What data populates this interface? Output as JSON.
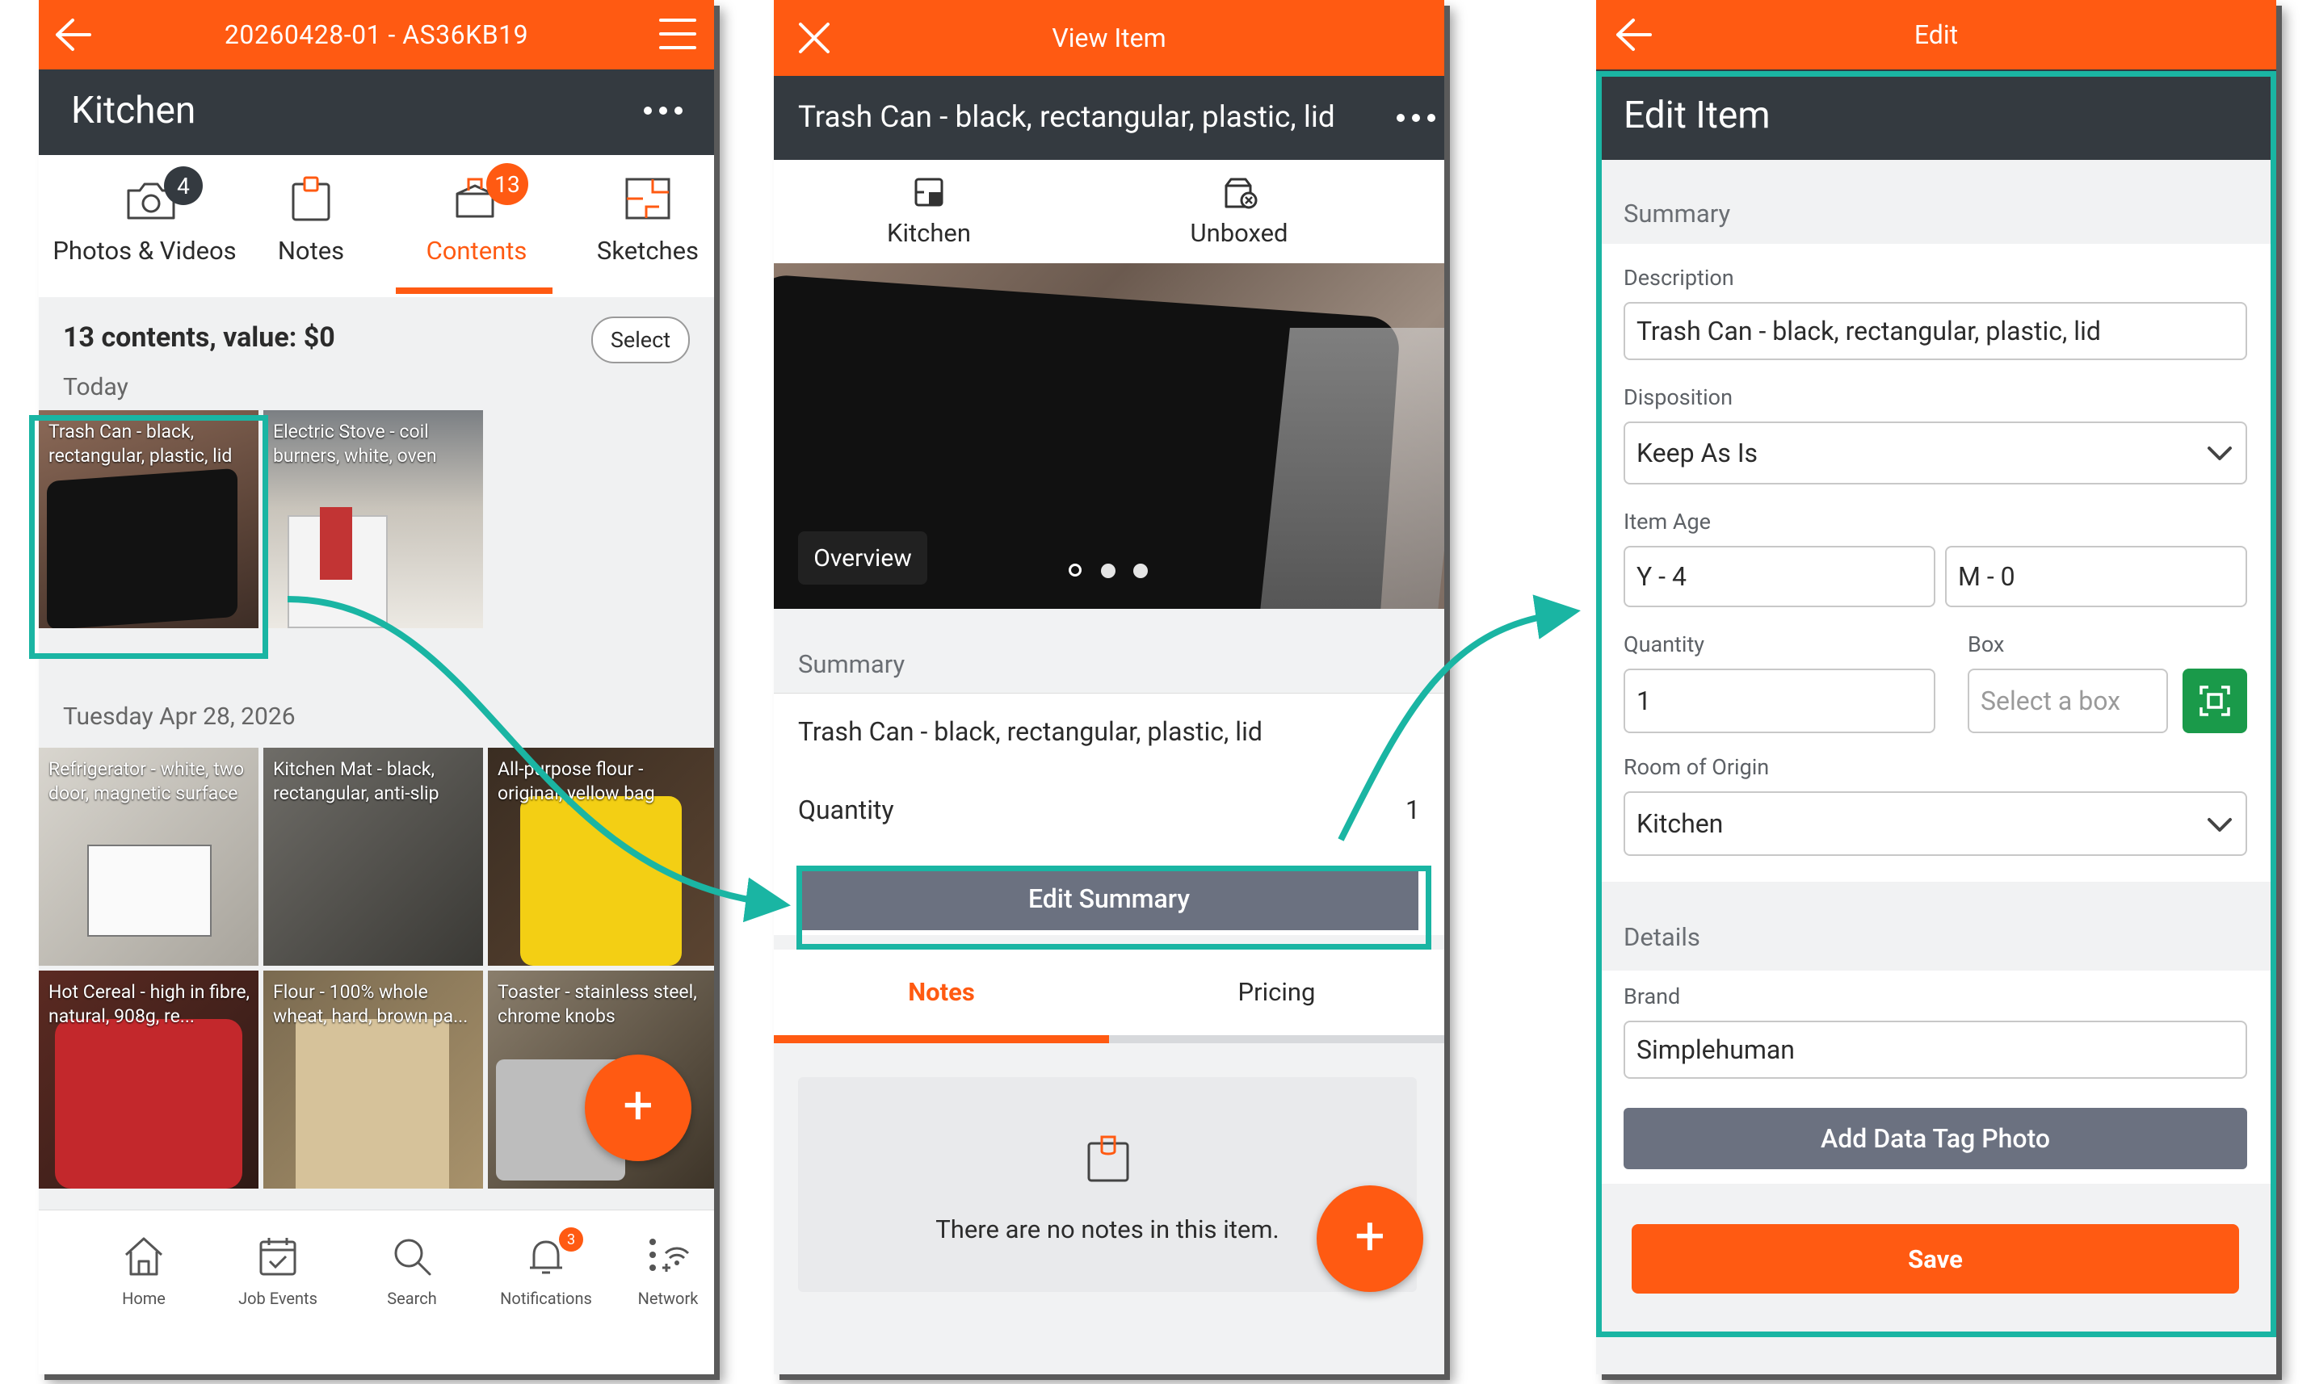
{
  "panel1": {
    "header_title": "20260428-01 - AS36KB19",
    "room_title": "Kitchen",
    "tabs": [
      {
        "label": "Photos & Videos",
        "badge": "4"
      },
      {
        "label": "Notes",
        "badge": ""
      },
      {
        "label": "Contents",
        "badge": "13"
      },
      {
        "label": "Sketches",
        "badge": ""
      }
    ],
    "contents_summary": "13 contents, value: $0",
    "select_label": "Select",
    "group_today": "Today",
    "group_date": "Tuesday Apr 28, 2026",
    "today_items": [
      {
        "caption": "Trash Can - black, rectangular, plastic, lid"
      },
      {
        "caption": "Electric Stove - coil burners, white, oven"
      }
    ],
    "dated_items": [
      {
        "caption": "Refrigerator - white, two door, magnetic surface"
      },
      {
        "caption": "Kitchen Mat - black, rectangular, anti-slip"
      },
      {
        "caption": "All-purpose flour - original, yellow bag"
      },
      {
        "caption": "Hot Cereal - high in fibre, natural, 908g, re..."
      },
      {
        "caption": "Flour - 100% whole wheat, hard, brown pa..."
      },
      {
        "caption": "Toaster - stainless steel, chrome knobs"
      }
    ],
    "fab_label": "+",
    "bottom_nav": [
      {
        "label": "Home",
        "icon": "home-icon"
      },
      {
        "label": "Job Events",
        "icon": "calendar-check-icon"
      },
      {
        "label": "Search",
        "icon": "search-icon"
      },
      {
        "label": "Notifications",
        "icon": "bell-icon",
        "badge": "3"
      },
      {
        "label": "Network",
        "icon": "network-icon"
      }
    ]
  },
  "panel2": {
    "header_title": "View Item",
    "item_title": "Trash Can - black, rectangular, plastic, lid",
    "room_label": "Kitchen",
    "status_label": "Unboxed",
    "image_badge": "Overview",
    "summary_header": "Summary",
    "summary_description": "Trash Can - black, rectangular, plastic, lid",
    "quantity_label": "Quantity",
    "quantity_value": "1",
    "edit_summary_label": "Edit Summary",
    "tabs": [
      "Notes",
      "Pricing"
    ],
    "empty_notes": "There are no notes in this item.",
    "fab_label": "+"
  },
  "panel3": {
    "header_title": "Edit",
    "form_title": "Edit Item",
    "summary_header": "Summary",
    "description_label": "Description",
    "description_value": "Trash Can - black, rectangular, plastic, lid",
    "disposition_label": "Disposition",
    "disposition_value": "Keep As Is",
    "item_age_label": "Item Age",
    "age_years": "Y - 4",
    "age_months": "M - 0",
    "quantity_label": "Quantity",
    "quantity_value": "1",
    "box_label": "Box",
    "box_placeholder": "Select a box",
    "room_label": "Room of Origin",
    "room_value": "Kitchen",
    "details_header": "Details",
    "brand_label": "Brand",
    "brand_value": "Simplehuman",
    "add_tag_label": "Add Data Tag Photo",
    "save_label": "Save"
  },
  "colors": {
    "accent": "#ff5a12",
    "header_dark": "#343a40",
    "highlight": "#1ab5a3",
    "button_gray": "#6b7180",
    "scan_green": "#1a9a4a"
  }
}
